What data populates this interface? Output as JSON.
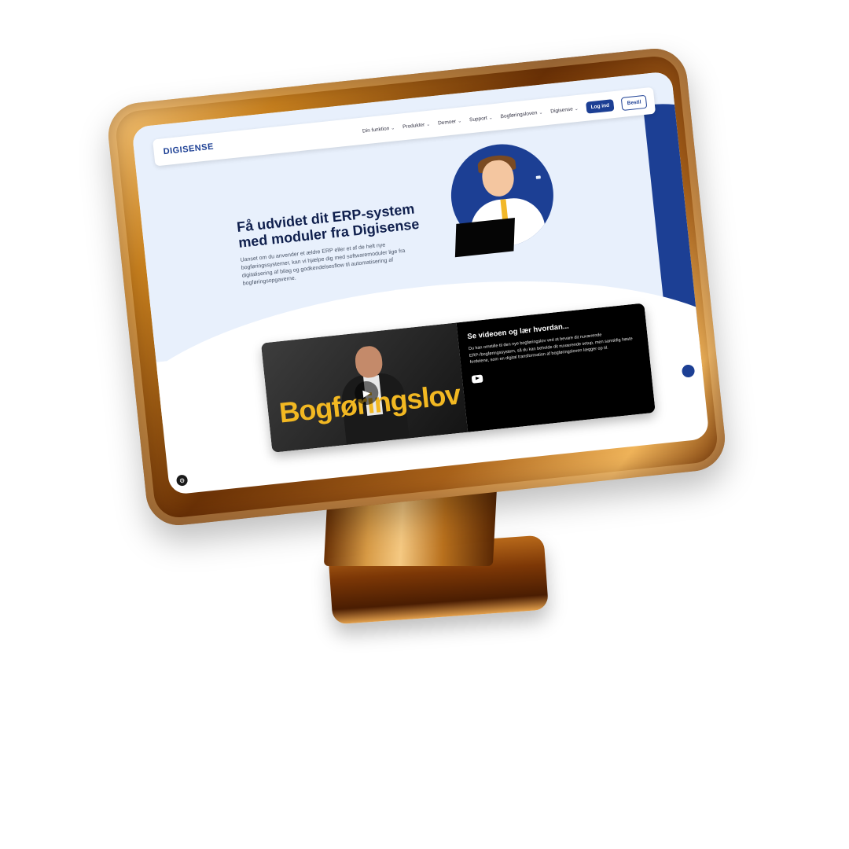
{
  "site": {
    "logo": "DIGISENSE",
    "nav": [
      {
        "label": "Din funktion"
      },
      {
        "label": "Produkter"
      },
      {
        "label": "Demoer"
      },
      {
        "label": "Support"
      },
      {
        "label": "Bogføringsloven"
      },
      {
        "label": "Digisense"
      }
    ],
    "login_label": "Log ind",
    "order_label": "Bestil"
  },
  "hero": {
    "title": "Få udvidet dit ERP-system med moduler fra Digisense",
    "body": "Uanset om du anvender et ældre ERP eller et af de helt nye bogføringssystemer, kan vi hjælpe dig med softwaremoduler lige fra digitalisering af bilag og godkendelsesflow til automatisering af bogføringsopgaverne."
  },
  "video": {
    "thumb_title": "Bogføringslov",
    "heading": "Se videoen og lær hvordan...",
    "description": "Du kan omstille til den nye bogføringslov ved at bevare dit nuværende ERP-/bogføringssystem, så du kan beholde dit nuværende setup, men samtidig høste fordelene, som en digital transformation af bogføringsloven lægger op til."
  },
  "colors": {
    "brand": "#1c3f94",
    "accent": "#f2b822",
    "hero_bg": "#e8f0fc",
    "frame": "#b8701d"
  },
  "icons": {
    "chevron": "chevron-down-icon",
    "play": "play-icon",
    "youtube": "youtube-icon",
    "chat": "chat-icon",
    "cookie": "cookie-icon"
  }
}
